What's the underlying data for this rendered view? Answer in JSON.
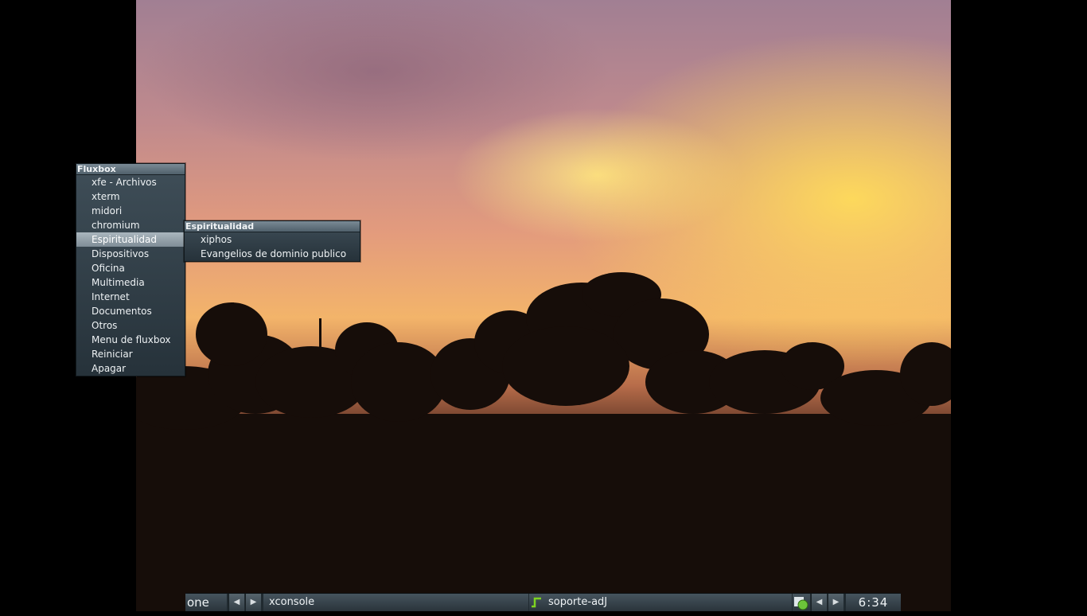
{
  "root_menu": {
    "title": "Fluxbox",
    "items": [
      {
        "label": "xfe - Archivos"
      },
      {
        "label": "xterm"
      },
      {
        "label": "midori"
      },
      {
        "label": "chromium"
      },
      {
        "label": "Espiritualidad",
        "active": true
      },
      {
        "label": "Dispositivos"
      },
      {
        "label": "Oficina"
      },
      {
        "label": "Multimedia"
      },
      {
        "label": "Internet"
      },
      {
        "label": "Documentos"
      },
      {
        "label": "Otros"
      },
      {
        "label": "Menu de fluxbox"
      },
      {
        "label": "Reiniciar"
      },
      {
        "label": "Apagar"
      }
    ]
  },
  "submenu": {
    "title": "Espiritualidad",
    "items": [
      {
        "label": "xiphos"
      },
      {
        "label": "Evangelios de dominio publico"
      }
    ]
  },
  "toolbar": {
    "workspace": "one",
    "prev_symbol": "◀",
    "next_symbol": "▶",
    "tasks": [
      {
        "label": "xconsole"
      },
      {
        "label": "soporte-adJ",
        "icon": "terminal-icon"
      }
    ],
    "clock": "6:34",
    "tray_icon": "network-status-icon"
  },
  "colors": {
    "menu_bg": "#2f3b43",
    "menu_highlight": "#8e9ba3",
    "toolbar_bg": "#2a343b",
    "terminal_icon": "#7ed321"
  }
}
